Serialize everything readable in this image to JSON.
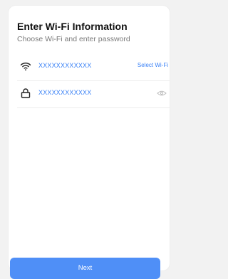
{
  "header": {
    "title": "Enter Wi-Fi Information",
    "subtitle": "Choose Wi-Fi and enter password"
  },
  "wifi": {
    "icon": "wifi-icon",
    "ssid": "XXXXXXXXXXXX",
    "select_label": "Select Wi-Fi"
  },
  "password": {
    "icon": "lock-icon",
    "value": "XXXXXXXXXXXX",
    "toggle_icon": "eye-icon"
  },
  "footer": {
    "next_label": "Next"
  },
  "colors": {
    "accent": "#3b82f6",
    "button": "#4f8ff7",
    "background": "#f2f2f2"
  }
}
